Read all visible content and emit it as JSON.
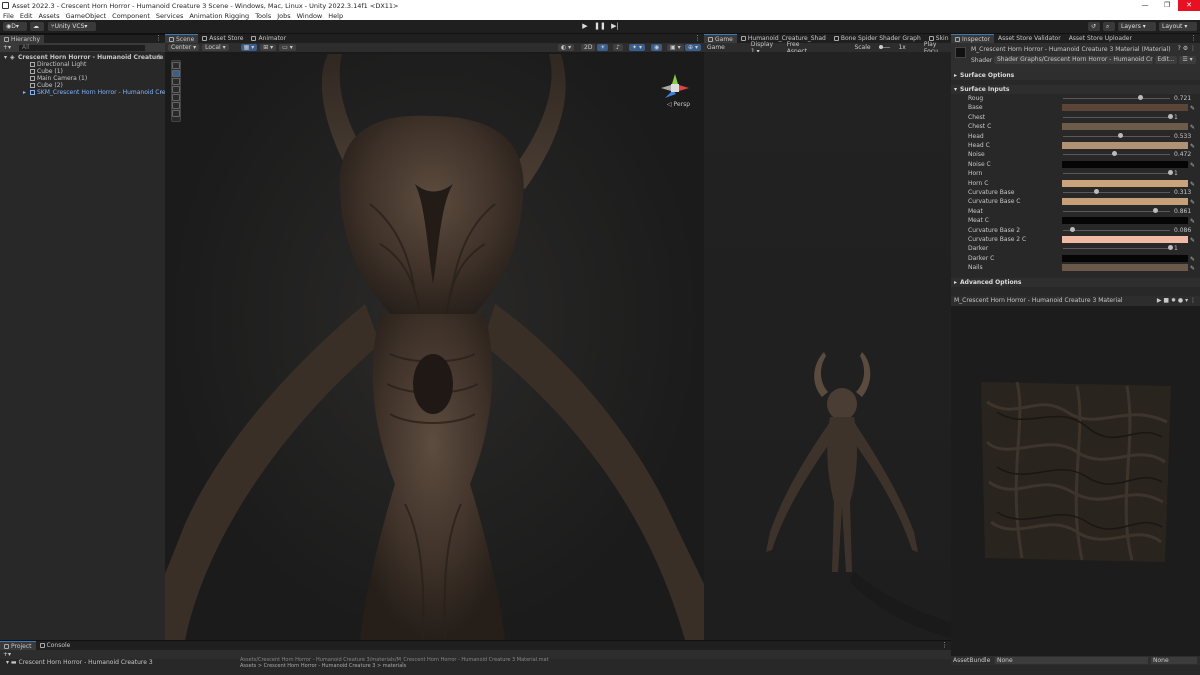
{
  "window": {
    "title": "Asset 2022.3 - Crescent Horn Horror - Humanoid Creature 3 Scene - Windows, Mac, Linux - Unity 2022.3.14f1 <DX11>",
    "minimize": "—",
    "maximize": "❐",
    "close": "✕"
  },
  "menu": [
    "File",
    "Edit",
    "Assets",
    "GameObject",
    "Component",
    "Services",
    "Animation Rigging",
    "Tools",
    "Jobs",
    "Window",
    "Help"
  ],
  "toolbar": {
    "account": "D",
    "vcs": "Unity VCS",
    "layers": "Layers",
    "layout": "Layout"
  },
  "hierarchy": {
    "tab": "Hierarchy",
    "search_placeholder": "All",
    "scene": "Crescent Horn Horror - Humanoid Creature 3",
    "items": [
      "Directional Light",
      "Main Camera (1)",
      "Cube (1)",
      "Main Camera (1)",
      "Cube (2)",
      "SKM_Crescent Horn Horror - Humanoid Creat"
    ]
  },
  "scene": {
    "tabs": [
      "Scene",
      "Asset Store",
      "Animator"
    ],
    "pivot": "Center",
    "space": "Local",
    "mode2d": "2D",
    "persp": "◁ Persp"
  },
  "game": {
    "tabs": [
      "Game",
      "Humanoid_Creature_Shad",
      "Bone Spider Shader Graph",
      "Skin"
    ],
    "display_mode": "Game",
    "display": "Display 1",
    "aspect": "Free Aspect",
    "scale_label": "Scale",
    "scale_value": "1x",
    "play_focus": "Play Focu"
  },
  "inspector": {
    "tabs": [
      "Inspector",
      "Asset Store Validator",
      "Asset Store Uploader"
    ],
    "material_name": "M_Crescent Horn Horror - Humanoid Creature 3 Material (Material)",
    "shader_label": "Shader",
    "shader_value": "Shader Graphs/Crescent Horn Horror - Humanoid Creatur",
    "edit_label": "Edit...",
    "surface_options": "Surface Options",
    "surface_inputs": "Surface Inputs",
    "advanced_options": "Advanced Options",
    "properties": [
      {
        "label": "Roug",
        "type": "slider",
        "value": "0.721",
        "fraction": 0.721
      },
      {
        "label": "Base",
        "type": "color",
        "color": "#5b4536"
      },
      {
        "label": "Chest",
        "type": "slider",
        "value": "1",
        "fraction": 1.0
      },
      {
        "label": "Chest C",
        "type": "color",
        "color": "#6e5c4a"
      },
      {
        "label": "Head",
        "type": "slider",
        "value": "0.533",
        "fraction": 0.533
      },
      {
        "label": "Head C",
        "type": "color",
        "color": "#b09274"
      },
      {
        "label": "Noise",
        "type": "slider",
        "value": "0.472",
        "fraction": 0.472
      },
      {
        "label": "Noise C",
        "type": "color",
        "color": "#050505"
      },
      {
        "label": "Horn",
        "type": "slider",
        "value": "1",
        "fraction": 1.0
      },
      {
        "label": "Horn C",
        "type": "color",
        "color": "#c8a37c"
      },
      {
        "label": "Curvature Base",
        "type": "slider",
        "value": "0.313",
        "fraction": 0.313
      },
      {
        "label": "Curvature Base C",
        "type": "color",
        "color": "#c7a07a"
      },
      {
        "label": "Meat",
        "type": "slider",
        "value": "0.861",
        "fraction": 0.861
      },
      {
        "label": "Meat C",
        "type": "color",
        "color": "#050505"
      },
      {
        "label": "Curvature Base 2",
        "type": "slider",
        "value": "0.086",
        "fraction": 0.086
      },
      {
        "label": "Curvature Base 2 C",
        "type": "color",
        "color": "#f0b9a4"
      },
      {
        "label": "Darker",
        "type": "slider",
        "value": "1",
        "fraction": 1.0
      },
      {
        "label": "Darker C",
        "type": "color",
        "color": "#060606"
      },
      {
        "label": "Nails",
        "type": "color",
        "color": "#6a5848"
      }
    ],
    "preview_title": "M_Crescent Horn Horror - Humanoid Creature 3 Material",
    "assetbundle_label": "AssetBundle",
    "assetbundle_value": "None",
    "variant_value": "None"
  },
  "bottom": {
    "tabs": [
      "Project",
      "Console"
    ],
    "favorite": "Crescent Horn Horror - Humanoid Creature 3",
    "path": "Assets/Crescent Horn Horror - Humanoid Creature 3/materials/M_Crescent Horn Horror - Humanoid Creature 3 Material.mat",
    "breadcrumb": "Assets > Crescent Horn Horror - Humanoid Creature 3 > materials"
  }
}
